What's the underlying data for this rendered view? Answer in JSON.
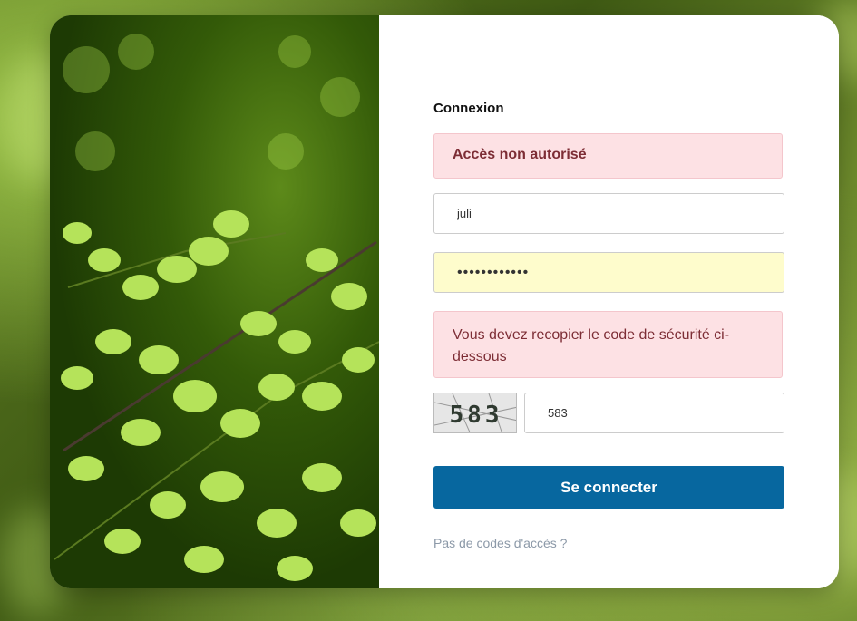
{
  "login": {
    "title": "Connexion",
    "error_message": "Accès non autorisé",
    "username_value": "juli",
    "password_mask": "••••••••••••",
    "captcha_error": "Vous devez recopier le code de sécurité ci-dessous",
    "captcha_image_text": "583",
    "captcha_value": "583",
    "submit_label": "Se connecter",
    "no_access_link": "Pas de codes d'accès ?"
  },
  "colors": {
    "primary_button": "#07679f",
    "error_bg": "#fde1e4",
    "error_text": "#7d2d35",
    "autofill_bg": "#fefccc",
    "link": "#8c99a8"
  },
  "icons": [
    "fern-photo",
    "captcha-image"
  ]
}
